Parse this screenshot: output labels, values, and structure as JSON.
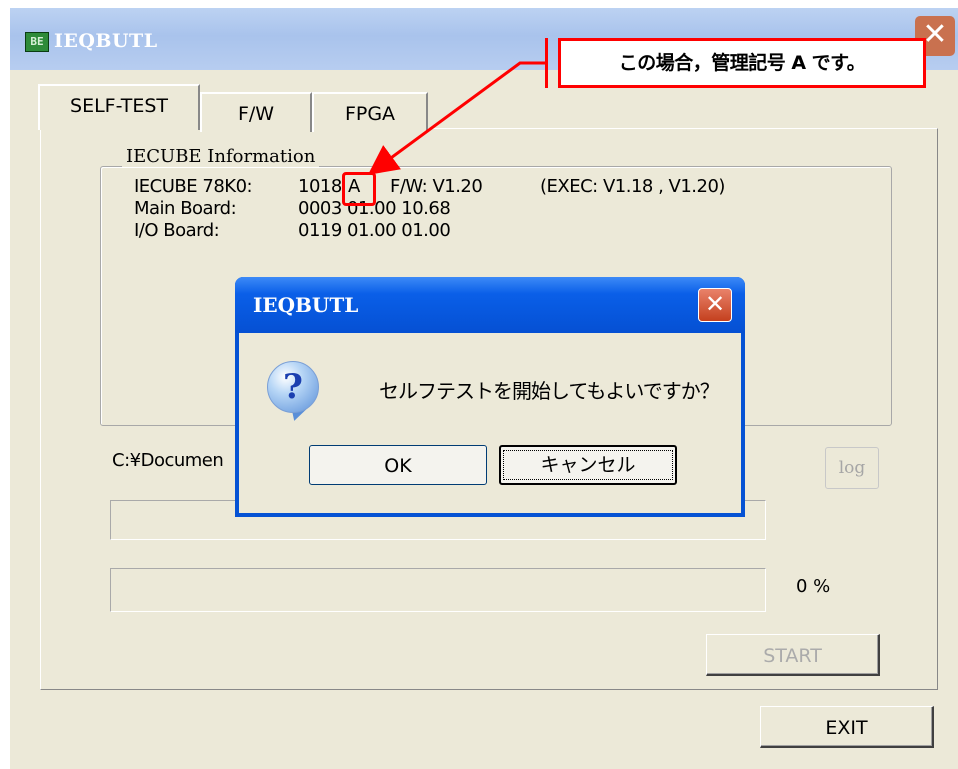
{
  "main_window": {
    "title": "IEQBUTL",
    "icon_glyph": "BE",
    "close_glyph": "✕"
  },
  "tabs": [
    {
      "label": "SELF-TEST",
      "selected": true
    },
    {
      "label": "F/W",
      "selected": false
    },
    {
      "label": "FPGA",
      "selected": false
    }
  ],
  "info_group": {
    "legend": "IECUBE Information",
    "rows": [
      {
        "label": "IECUBE 78K0:",
        "value": "1018",
        "mark": "A",
        "fw": "F/W: V1.20",
        "exec": "(EXEC: V1.18 , V1.20)"
      },
      {
        "label": "Main Board:",
        "value": "0003 01.00 10.68"
      },
      {
        "label": "I/O Board:",
        "value": "0119 01.00 01.00"
      }
    ]
  },
  "path_text": "C:¥Documen",
  "log_button": "log",
  "progress": {
    "bar1_fraction": 0,
    "bar2_fraction": 0,
    "percent_text": "0 %"
  },
  "start_button": "START",
  "exit_button": "EXIT",
  "dialog": {
    "title": "IEQBUTL",
    "close_glyph": "✕",
    "icon_glyph": "?",
    "message": "セルフテストを開始してもよいですか？",
    "ok": "OK",
    "cancel": "キャンセル"
  },
  "annotation": {
    "text": "この場合，管理記号 A です。",
    "color": "#ff0000"
  },
  "colors": {
    "window_face": "#ece9d8",
    "dialog_title_blue": "#0552d4",
    "close_red": "#c4401e"
  }
}
